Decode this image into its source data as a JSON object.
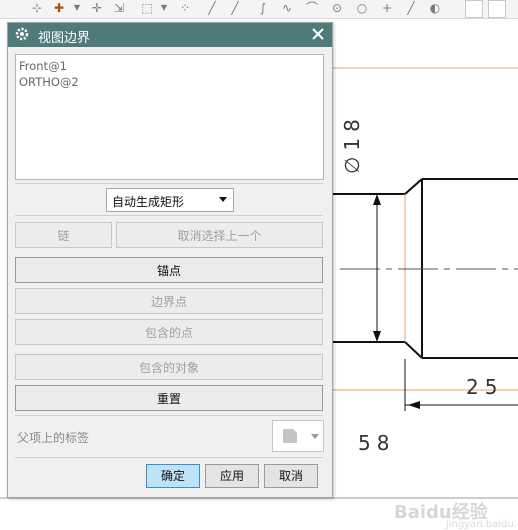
{
  "dialog": {
    "title": "视图边界",
    "list_items": [
      "Front@1",
      "ORTHO@2"
    ],
    "mode_select": {
      "value": "自动生成矩形"
    },
    "buttons": {
      "chain": "链",
      "deselect_previous": "取消选择上一个",
      "anchor_point": "锚点",
      "boundary_point": "边界点",
      "included_points": "包含的点",
      "included_objects": "包含的对象",
      "reset": "重置"
    },
    "parent_label": "父项上的标签",
    "footer": {
      "ok": "确定",
      "apply": "应用",
      "cancel": "取消"
    }
  },
  "drawing": {
    "diameter_dim": "∅18",
    "dim_25": "25",
    "dim_58": "58"
  },
  "watermark": {
    "brand": "Baidu经验",
    "sub": "jingyan.baidu.com"
  },
  "colors": {
    "titlebar": "#4f7a7a",
    "primary_button": "#bfe3f6",
    "orange_line": "#e8a060"
  },
  "icons": [
    "pin-icon",
    "arrow-icon",
    "dotted-rectangle-icon",
    "line-icon",
    "curve-icon",
    "circle-icon",
    "crosshair-icon",
    "gear-icon",
    "close-icon",
    "chevron-down-icon",
    "label-style-icon"
  ]
}
